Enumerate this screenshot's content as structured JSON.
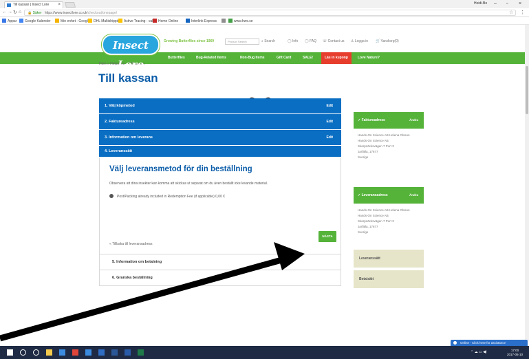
{
  "browser": {
    "tab_title": "Till kassan | Insect Lore",
    "profile_name": "Heidi-Bo",
    "url_label": "Säker",
    "url_host": "https://www.insectlore.co.uk",
    "url_path": "/checkout/onepage/",
    "bookmarks": [
      {
        "label": "Appar",
        "color": "#3b78e7"
      },
      {
        "label": "Google Kalender",
        "color": "#4285f4"
      },
      {
        "label": "Min enhet - Googl",
        "color": "#f4b400"
      },
      {
        "label": "DHL Multishipping",
        "color": "#fcc200"
      },
      {
        "label": "Active Tracing - val",
        "color": "#fcc200"
      },
      {
        "label": "Home Online",
        "color": "#c62828"
      },
      {
        "label": "Interlink Express",
        "color": "#1565c0"
      },
      {
        "label": "",
        "color": "#8e8e8e"
      },
      {
        "label": "www.hws.se",
        "color": "#43a047"
      }
    ]
  },
  "site": {
    "logo_text": "Insect Lore",
    "tagline": "Growing Butterflies since 1969",
    "search_placeholder": "Product Search",
    "search_button": "Search",
    "top_links": [
      "Info",
      "FAQ",
      "Contact us",
      "Logga in",
      "Varukorg(0)"
    ],
    "nav": [
      {
        "label": "Butterflies",
        "active": false
      },
      {
        "label": "Bug-Related Items",
        "active": false
      },
      {
        "label": "Non-Bug Items",
        "active": false
      },
      {
        "label": "Gift Card",
        "active": false
      },
      {
        "label": "SALE!",
        "active": false
      },
      {
        "label": "Läs in kuponp",
        "active": true
      },
      {
        "label": "Love Nature?",
        "active": false
      }
    ]
  },
  "checkout": {
    "breadcrumb": "Hem » Helpsters » Till kassan",
    "title": "Till kassan",
    "steps": [
      {
        "label": "1. Välj köpmetod",
        "edit": "Edit"
      },
      {
        "label": "2. Faktureadress",
        "edit": "Edit"
      },
      {
        "label": "3. Information om leverans",
        "edit": "Edit"
      },
      {
        "label": "4. Leveranssätt",
        "edit": ""
      }
    ],
    "panel_title": "Välj leveransmetod för din beställning",
    "panel_note": "Observera att dina insekter kan komma att skickas ut separat om du även beställt icke levande material.",
    "shipping_option": "Post/Packing already included in Redemption Fee (if applicable) 0,00 €",
    "next_button": "NÄSTA",
    "back_link": "« Tillbaka till leveransadress",
    "later_steps": [
      "5. Information om betalning",
      "6. Granska beställning"
    ]
  },
  "sidebar": {
    "billing": {
      "title": "Faktureadress",
      "change": "Ändra",
      "lines": [
        "Hands-On Science AB Helena Olsson",
        "Hands-On Science AB",
        "Skarpnäcksvägen 7 Port 3",
        "Jarfälla, 17677",
        "Sverige"
      ]
    },
    "shipping": {
      "title": "Leveransadress",
      "change": "Ändra",
      "lines": [
        "Hands-On Science AB Helena Olsson",
        "Hands-On Science AB",
        "Skarpnäcksvägen 7 Port 3",
        "Jarfälla, 17677",
        "Sverige"
      ]
    },
    "shipping_method": "Leveranssätt",
    "payment_method": "Betalsätt"
  },
  "chat": {
    "label": "Online - Click here for assistance"
  },
  "taskbar": {
    "apps": [
      {
        "icon": "windows-start-icon",
        "color": "#ffffff"
      },
      {
        "icon": "search-icon",
        "color": "#ffffff"
      },
      {
        "icon": "task-view-icon",
        "color": "#ffffff"
      },
      {
        "icon": "file-explorer-icon",
        "color": "#f2c94c"
      },
      {
        "icon": "store-icon",
        "color": "#3b8be0"
      },
      {
        "icon": "chrome-icon",
        "color": "#e0463a"
      },
      {
        "icon": "edge-icon",
        "color": "#3b8be0"
      },
      {
        "icon": "outlook-icon",
        "color": "#2f6cc3"
      },
      {
        "icon": "word-icon",
        "color": "#2b5797"
      },
      {
        "icon": "photoshop-icon",
        "color": "#2a5ba8"
      },
      {
        "icon": "publisher-icon",
        "color": "#1f7a4a"
      }
    ],
    "time": "17:00",
    "date": "2017-05-10"
  }
}
